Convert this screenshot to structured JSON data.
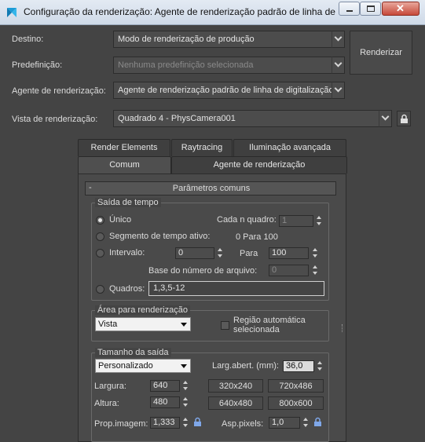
{
  "window": {
    "title": "Configuração da renderização: Agente de renderização padrão de linha de digitalização",
    "app_icon": "3dsmax-logo-icon"
  },
  "top": {
    "destino_label": "Destino:",
    "destino_value": "Modo de renderização de produção",
    "predef_label": "Predefinição:",
    "predef_value": "Nenhuma predefinição selecionada",
    "agente_label": "Agente de renderização:",
    "agente_value": "Agente de renderização padrão de linha de digitalização",
    "vista_label": "Vista de renderização:",
    "vista_value": "Quadrado 4 - PhysCamera001",
    "render_button": "Renderizar"
  },
  "tabs": {
    "row1": [
      "Render Elements",
      "Raytracing",
      "Iluminação avançada"
    ],
    "row2": [
      "Comum",
      "Agente de renderização"
    ],
    "active": "Comum"
  },
  "rollout": {
    "collapse_symbol": "-",
    "title": "Parâmetros comuns"
  },
  "saida_tempo": {
    "title": "Saída de tempo",
    "unico": "Único",
    "cada_n_label": "Cada n quadro:",
    "cada_n_value": "1",
    "segmento": "Segmento de tempo ativo:",
    "segmento_range": "0 Para 100",
    "intervalo": "Intervalo:",
    "intervalo_from": "0",
    "para_label": "Para",
    "intervalo_to": "100",
    "base_label": "Base do número de arquivo:",
    "base_value": "0",
    "quadros": "Quadros:",
    "quadros_value": "1,3,5-12",
    "selected": "Único"
  },
  "area": {
    "title": "Área para renderização",
    "dropdown": "Vista",
    "regiao_label": "Região automática selecionada",
    "regiao_checked": false
  },
  "tamanho": {
    "title": "Tamanho da saída",
    "preset": "Personalizado",
    "aperture_label": "Larg.abert. (mm):",
    "aperture_value": "36,0",
    "largura_label": "Largura:",
    "largura_value": "640",
    "altura_label": "Altura:",
    "altura_value": "480",
    "presets": [
      "320x240",
      "720x486",
      "640x480",
      "800x600"
    ],
    "prop_label": "Prop.imagem:",
    "prop_value": "1,333",
    "pixels_label": "Asp.pixels:",
    "pixels_value": "1,0"
  },
  "colors": {
    "panel": "#444444",
    "field": "#4c4c4c",
    "titlebar": "#dbe4ef",
    "lock_active": "#7fa7e8"
  }
}
